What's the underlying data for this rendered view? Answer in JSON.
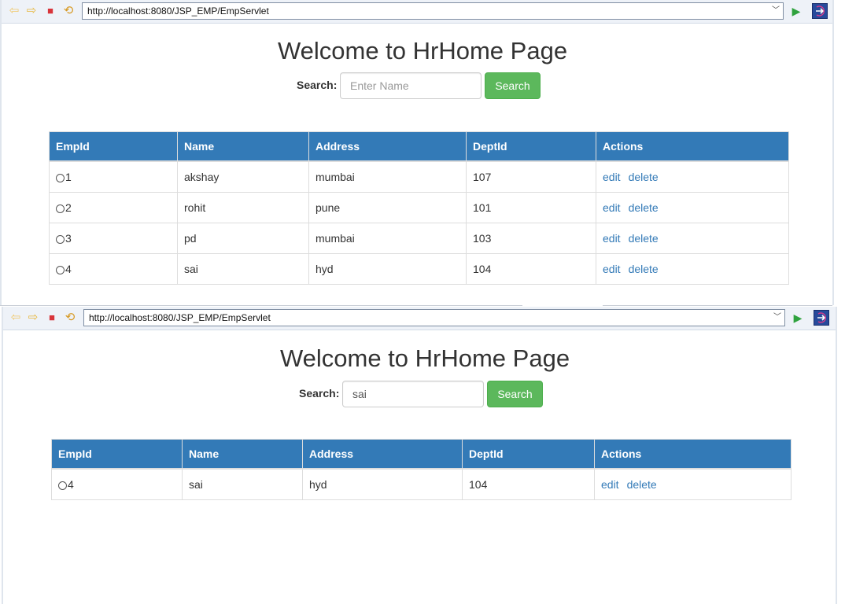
{
  "screens": [
    {
      "browser": {
        "url": "http://localhost:8080/JSP_EMP/EmpServlet"
      },
      "page": {
        "title": "Welcome to HrHome Page",
        "search_label": "Search:",
        "search_placeholder": "Enter Name",
        "search_value": "",
        "search_button": "Search"
      },
      "table": {
        "headers": [
          "EmpId",
          "Name",
          "Address",
          "DeptId",
          "Actions"
        ],
        "rows": [
          {
            "id": "1",
            "name": "akshay",
            "address": "mumbai",
            "dept": "107",
            "edit": "edit",
            "delete": "delete"
          },
          {
            "id": "2",
            "name": "rohit",
            "address": "pune",
            "dept": "101",
            "edit": "edit",
            "delete": "delete"
          },
          {
            "id": "3",
            "name": "pd",
            "address": "mumbai",
            "dept": "103",
            "edit": "edit",
            "delete": "delete"
          },
          {
            "id": "4",
            "name": "sai",
            "address": "hyd",
            "dept": "104",
            "edit": "edit",
            "delete": "delete"
          }
        ]
      }
    },
    {
      "browser": {
        "url": "http://localhost:8080/JSP_EMP/EmpServlet"
      },
      "page": {
        "title": "Welcome to HrHome Page",
        "search_label": "Search:",
        "search_placeholder": "Enter Name",
        "search_value": "sai",
        "search_button": "Search"
      },
      "table": {
        "headers": [
          "EmpId",
          "Name",
          "Address",
          "DeptId",
          "Actions"
        ],
        "rows": [
          {
            "id": "4",
            "name": "sai",
            "address": "hyd",
            "dept": "104",
            "edit": "edit",
            "delete": "delete"
          }
        ]
      }
    }
  ],
  "icons": {
    "back": "back-arrow-icon",
    "forward": "forward-arrow-icon",
    "stop": "stop-icon",
    "refresh": "refresh-icon",
    "go": "go-icon",
    "external": "open-external-browser-icon"
  },
  "colors": {
    "header_bg": "#337ab7",
    "search_button_bg": "#5cb85c",
    "link": "#337ab7"
  }
}
